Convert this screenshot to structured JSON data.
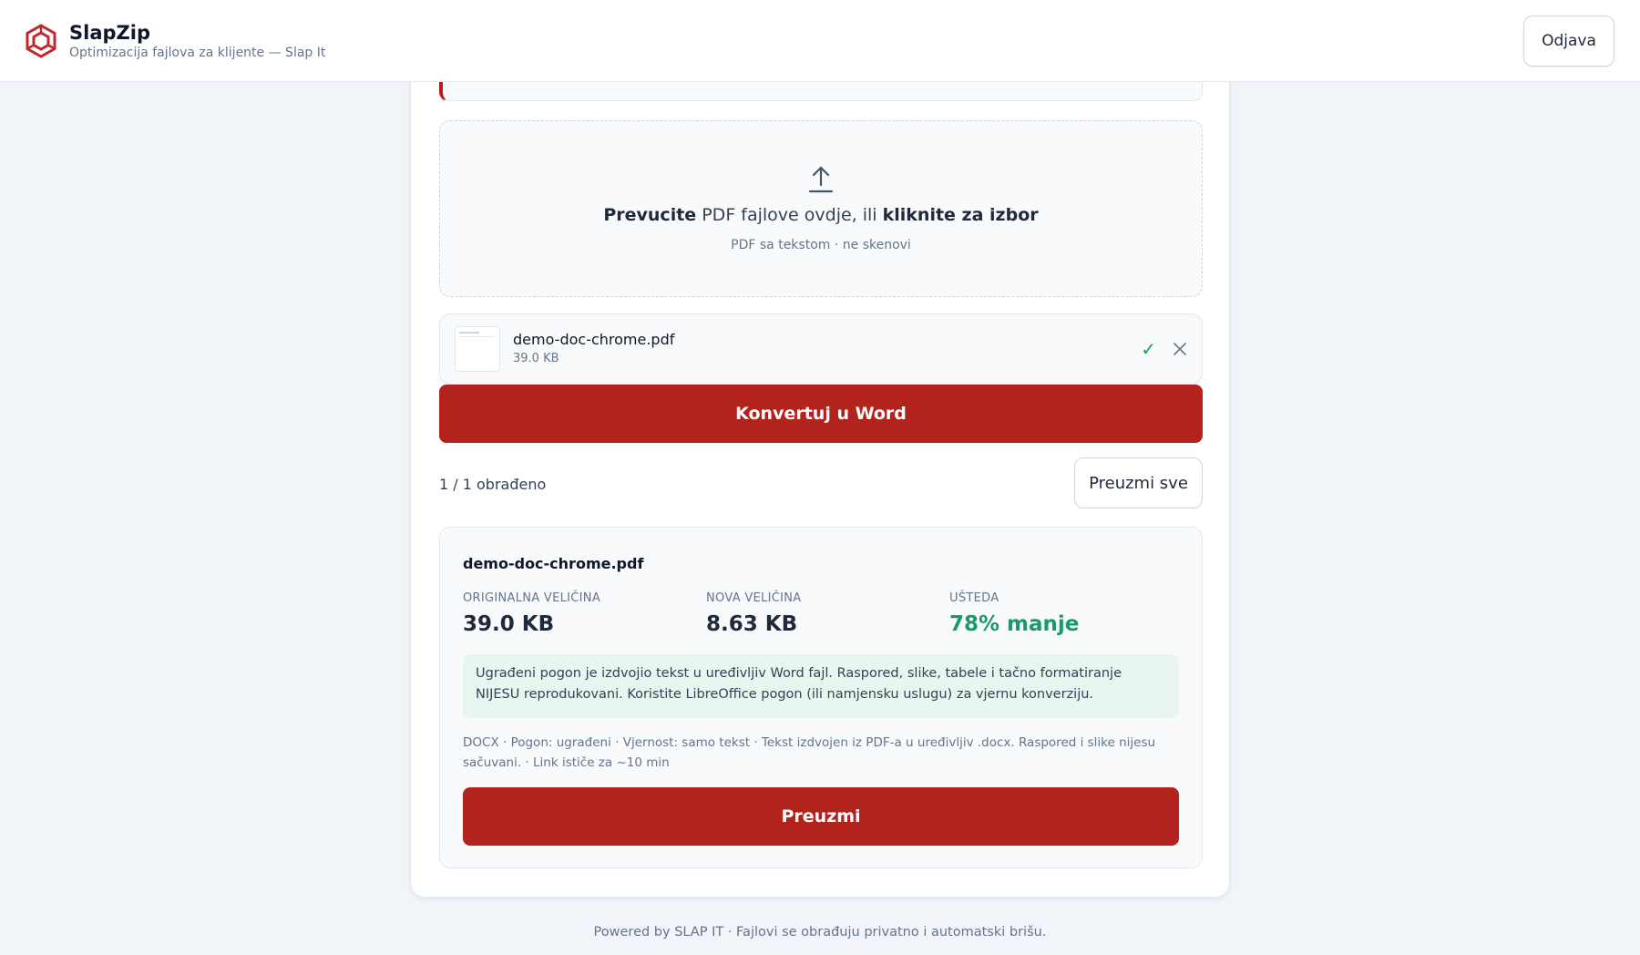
{
  "header": {
    "app_name": "SlapZip",
    "subtitle": "Optimizacija fajlova za klijente — Slap It",
    "logout_label": "Odjava",
    "brand_color": "#c0282b"
  },
  "dropzone": {
    "main_bold_1": "Prevucite",
    "main_mid": " PDF fajlove ovdje, ili ",
    "main_bold_2": "kliknite za izbor",
    "sub": "PDF sa tekstom · ne skenovi",
    "icon": "upload-icon"
  },
  "file": {
    "name": "demo-doc-chrome.pdf",
    "size": "39.0 KB",
    "status_icon": "check-icon",
    "remove_icon": "close-icon"
  },
  "convert_label": "Konvertuj u Word",
  "status": {
    "processed": "1 / 1 obrađeno",
    "download_all_label": "Preuzmi sve"
  },
  "result": {
    "file_name": "demo-doc-chrome.pdf",
    "stats": [
      {
        "label": "ORIGINALNA VELIČINA",
        "value": "39.0 KB"
      },
      {
        "label": "NOVA VELIČINA",
        "value": "8.63 KB"
      },
      {
        "label": "UŠTEDA",
        "value": "78% manje"
      }
    ],
    "info": "Ugrađeni pogon je izdvojio tekst u uređivljiv Word fajl. Raspored, slike, tabele i tačno formatiranje NIJESU reprodukovani. Koristite LibreOffice pogon (ili namjensku uslugu) za vjernu konverziju.",
    "meta": "DOCX · Pogon: ugrađeni · Vjernost: samo tekst · Tekst izdvojen iz PDF-a u uređivljiv .docx. Raspored i slike nijesu sačuvani. · Link ističe za ~10 min",
    "download_label": "Preuzmi"
  },
  "footer": "Powered by SLAP IT · Fajlovi se obrađuju privatno i automatski brišu.",
  "colors": {
    "primary": "#b3231e",
    "success": "#1a9a6c",
    "background": "#f1f5f9"
  }
}
